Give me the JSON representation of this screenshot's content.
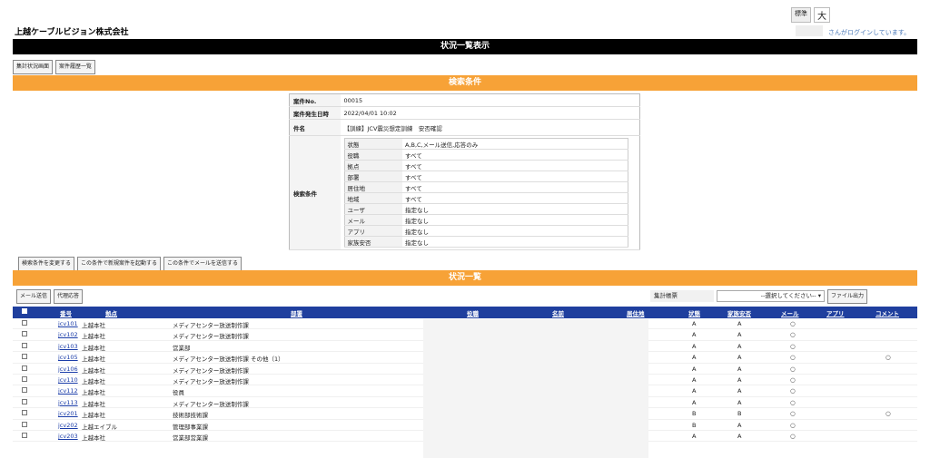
{
  "header": {
    "font_size_standard": "標準",
    "font_size_large": "大",
    "company": "上越ケーブルビジョン株式会社",
    "login_text": "さんがログインしています。"
  },
  "page_title": "状況一覧表示",
  "top_buttons": {
    "summary": "集計状況画面",
    "history": "案件履歴一覧"
  },
  "search_section_title": "検索条件",
  "case": {
    "no_label": "案件No.",
    "no_value": "00015",
    "date_label": "案件発生日時",
    "date_value": "2022/04/01 10:02",
    "subject_label": "件名",
    "subject_value": "【訓練】JCV震災想定訓練　安否確認",
    "conditions_label": "検索条件"
  },
  "conditions": [
    {
      "key": "状態",
      "value": "A,B,C,メール送信,応答のみ"
    },
    {
      "key": "役職",
      "value": "すべて"
    },
    {
      "key": "拠点",
      "value": "すべて"
    },
    {
      "key": "部署",
      "value": "すべて"
    },
    {
      "key": "居住地",
      "value": "すべて"
    },
    {
      "key": "地域",
      "value": "すべて"
    },
    {
      "key": "ユーザ",
      "value": "指定なし"
    },
    {
      "key": "メール",
      "value": "指定なし"
    },
    {
      "key": "アプリ",
      "value": "指定なし"
    },
    {
      "key": "家族安否",
      "value": "指定なし"
    }
  ],
  "action_buttons": {
    "change_conditions": "検索条件を変更する",
    "new_case": "この条件で新規案件を起動する",
    "send_mail": "この条件でメールを送信する"
  },
  "list_section_title": "状況一覧",
  "list_toolbar": {
    "send_mail": "メール送信",
    "proxy_answer": "代理応答",
    "tally_label": "集計帳票",
    "tally_select": "--選択してください--",
    "export": "ファイル出力"
  },
  "columns": {
    "number": "番号",
    "site": "拠点",
    "department": "部署",
    "position": "役職",
    "name": "名前",
    "residence": "居住地",
    "status": "状態",
    "family": "家族安否",
    "mail": "メール",
    "app": "アプリ",
    "comment": "コメント"
  },
  "rows": [
    {
      "id": "jcv101",
      "site": "上越本社",
      "dept": "メディアセンター放送制作課",
      "status": "A",
      "family": "A",
      "mail": "○",
      "comment": ""
    },
    {
      "id": "jcv102",
      "site": "上越本社",
      "dept": "メディアセンター放送制作課",
      "status": "A",
      "family": "A",
      "mail": "○",
      "comment": ""
    },
    {
      "id": "jcv103",
      "site": "上越本社",
      "dept": "営業部",
      "status": "A",
      "family": "A",
      "mail": "○",
      "comment": ""
    },
    {
      "id": "jcv105",
      "site": "上越本社",
      "dept": "メディアセンター放送制作課 その他（1）",
      "status": "A",
      "family": "A",
      "mail": "○",
      "comment": "○"
    },
    {
      "id": "jcv106",
      "site": "上越本社",
      "dept": "メディアセンター放送制作課",
      "status": "A",
      "family": "A",
      "mail": "○",
      "comment": ""
    },
    {
      "id": "jcv110",
      "site": "上越本社",
      "dept": "メディアセンター放送制作課",
      "status": "A",
      "family": "A",
      "mail": "○",
      "comment": ""
    },
    {
      "id": "jcv112",
      "site": "上越本社",
      "dept": "役員",
      "status": "A",
      "family": "A",
      "mail": "○",
      "comment": ""
    },
    {
      "id": "jcv113",
      "site": "上越本社",
      "dept": "メディアセンター放送制作課",
      "status": "A",
      "family": "A",
      "mail": "○",
      "comment": ""
    },
    {
      "id": "jcv201",
      "site": "上越本社",
      "dept": "技術部技術課",
      "status": "B",
      "family": "B",
      "mail": "○",
      "comment": "○"
    },
    {
      "id": "jcv202",
      "site": "上越エイブル",
      "dept": "管理部事業課",
      "status": "B",
      "family": "A",
      "mail": "○",
      "comment": ""
    },
    {
      "id": "jcv203",
      "site": "上越本社",
      "dept": "営業部営業課",
      "status": "A",
      "family": "A",
      "mail": "○",
      "comment": ""
    }
  ],
  "colors": {
    "title_bar": "#000000",
    "section_bar": "#f7a237",
    "grid_header": "#1f3f9e",
    "link": "#1a3ca8"
  }
}
